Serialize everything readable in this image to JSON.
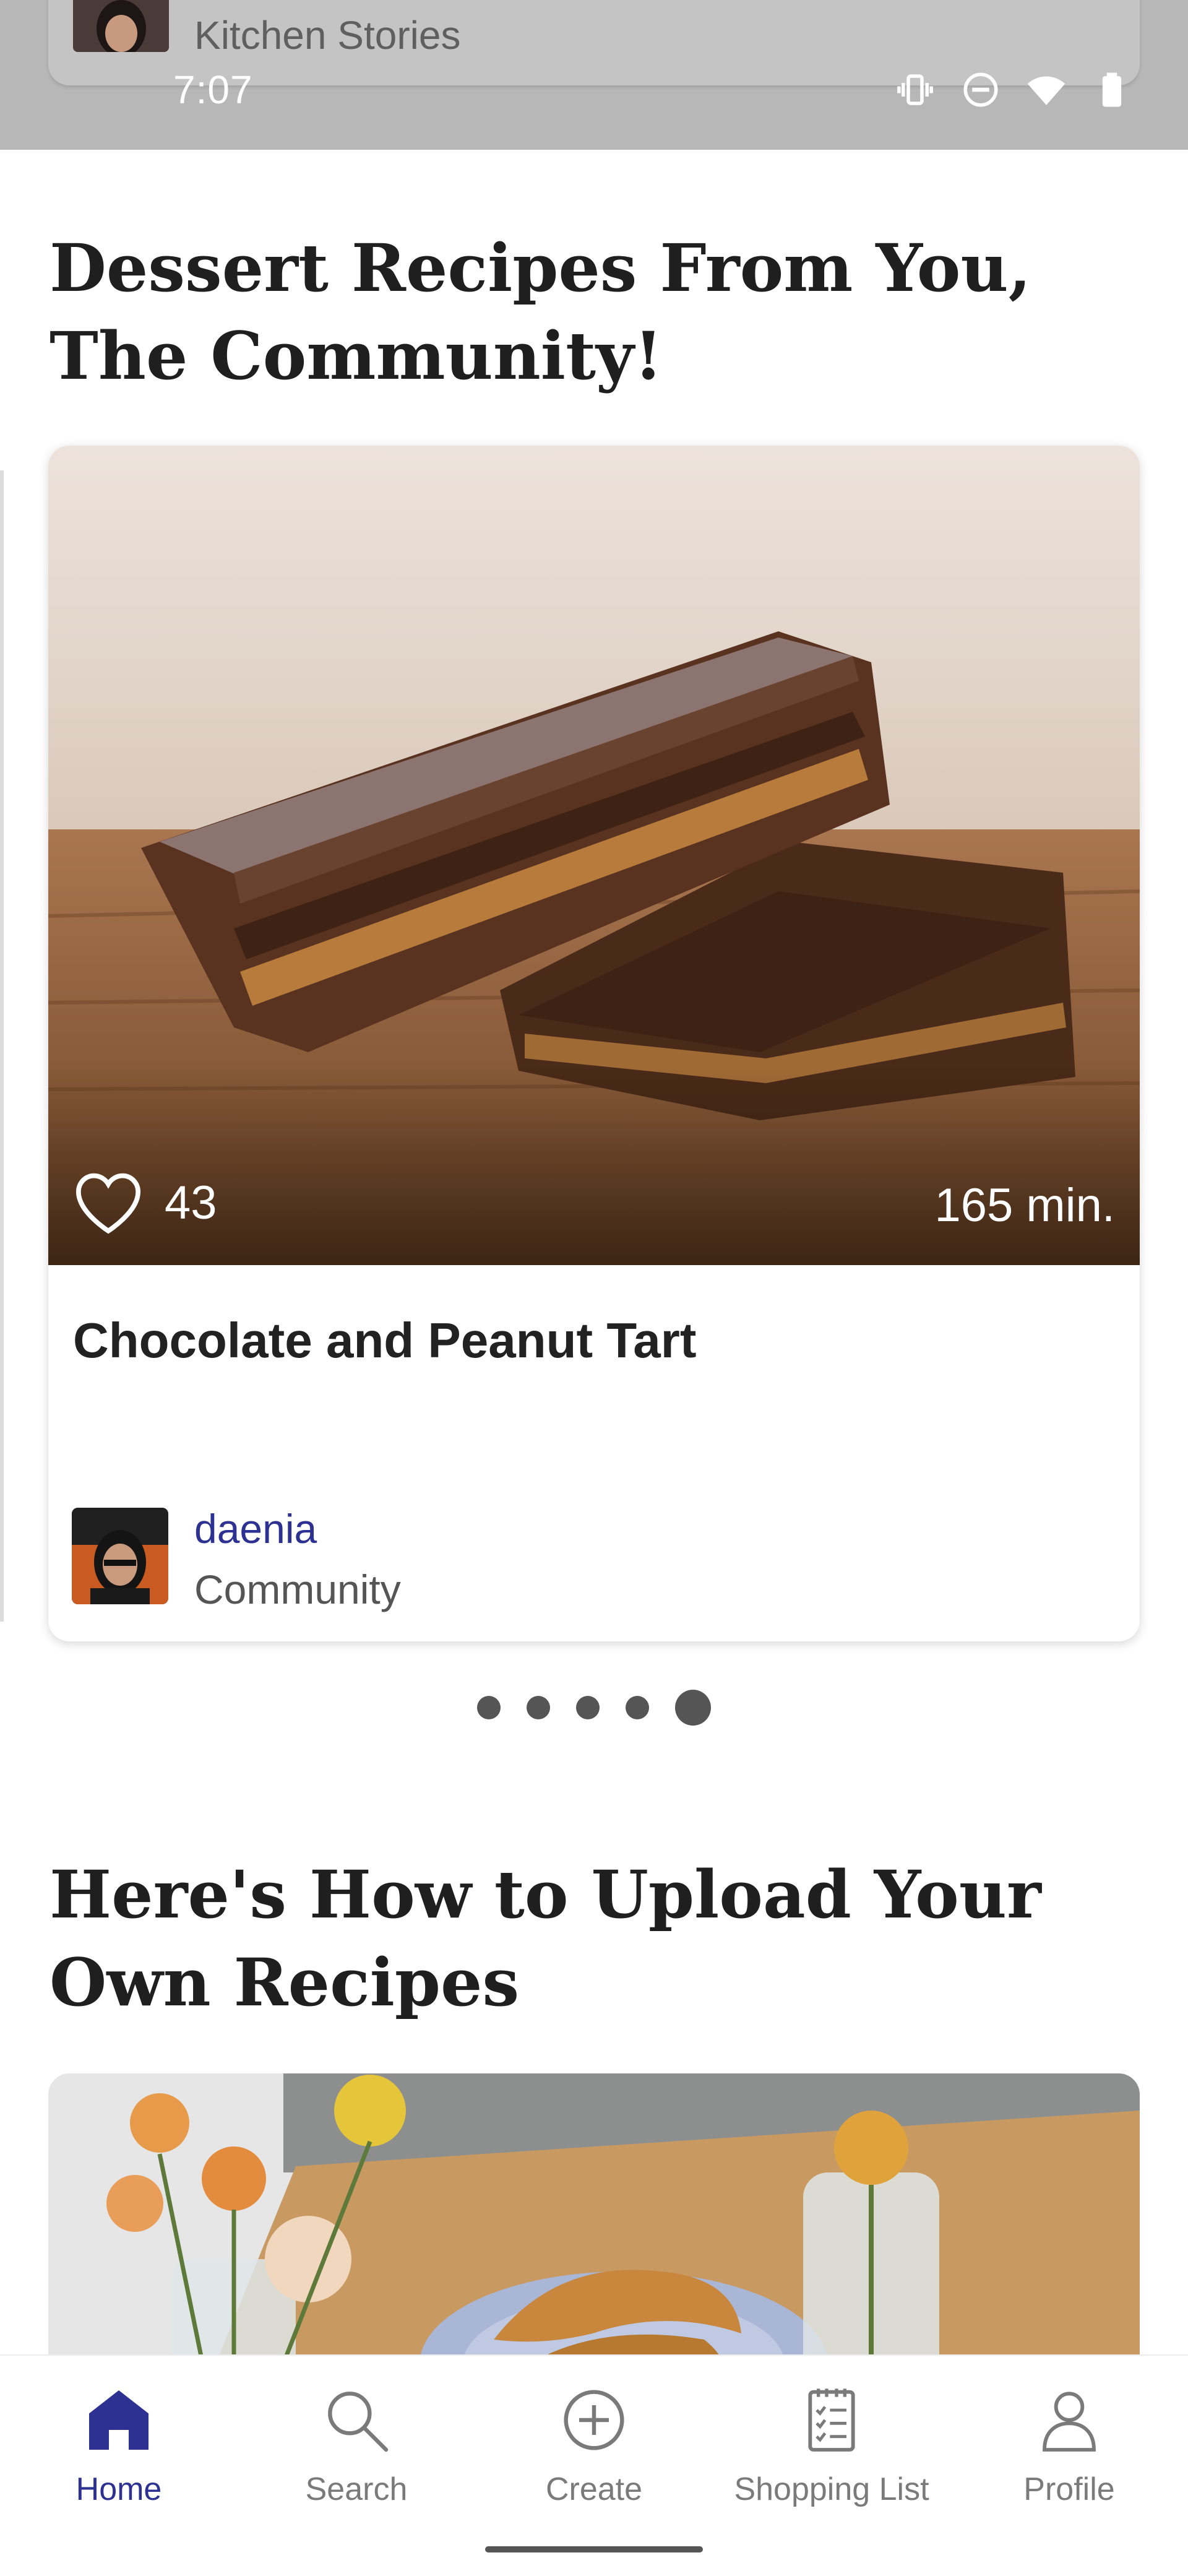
{
  "status_bar": {
    "time": "7:07",
    "icons": [
      "vibrate-icon",
      "do-not-disturb-icon",
      "wifi-icon",
      "battery-icon"
    ]
  },
  "previous_card": {
    "title": "Kitchen Stories"
  },
  "section1": {
    "title": "Dessert Recipes From You, The Community!"
  },
  "recipe_card": {
    "likes": "43",
    "duration": "165 min.",
    "title": "Chocolate and Peanut Tart",
    "author": "daenia",
    "author_type": "Community"
  },
  "pager": {
    "count": 5,
    "active_index": 4
  },
  "section2": {
    "title": "Here's How to Upload Your Own Recipes"
  },
  "bottom_nav": {
    "items": [
      {
        "label": "Home",
        "icon": "home-icon",
        "active": true
      },
      {
        "label": "Search",
        "icon": "search-icon",
        "active": false
      },
      {
        "label": "Create",
        "icon": "plus-circle-icon",
        "active": false
      },
      {
        "label": "Shopping List",
        "icon": "checklist-icon",
        "active": false
      },
      {
        "label": "Profile",
        "icon": "person-icon",
        "active": false
      }
    ]
  },
  "colors": {
    "accent": "#2d3192",
    "text_dark": "#1f1f1f",
    "text_muted": "#7a7a7a",
    "status_overlay": "#b7b7b7"
  }
}
